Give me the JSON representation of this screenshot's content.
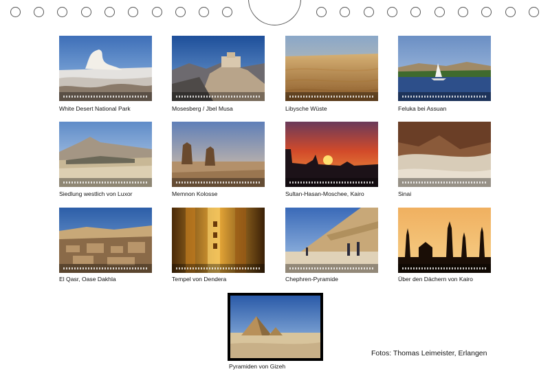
{
  "captions": {
    "c1": "White Desert National Park",
    "c2": "Mosesberg / Jbel Musa",
    "c3": "Libysche Wüste",
    "c4": "Feluka bei Assuan",
    "c5": "Siedlung westlich von Luxor",
    "c6": "Memnon Kolosse",
    "c7": "Sultan-Hasan-Moschee, Kairo",
    "c8": "Sinai",
    "c9": "El Qasr, Oase Dakhla",
    "c10": "Tempel von Dendera",
    "c11": "Chephren-Pyramide",
    "c12": "Über den Dächern von Kairo",
    "cover": "Pyramiden von Gizeh"
  },
  "credit": "Fotos: Thomas Leimeister, Erlangen"
}
